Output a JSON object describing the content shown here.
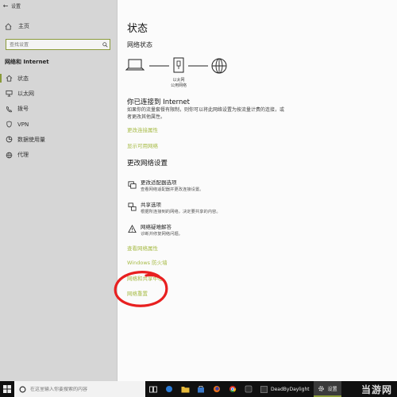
{
  "window": {
    "title": "设置"
  },
  "sidebar": {
    "home_label": "主页",
    "search_placeholder": "查找设置",
    "section_title": "网络和 Internet",
    "items": [
      {
        "label": "状态",
        "icon": "home-status-icon",
        "active": true
      },
      {
        "label": "以太网",
        "icon": "ethernet-icon",
        "active": false
      },
      {
        "label": "拨号",
        "icon": "phone-icon",
        "active": false
      },
      {
        "label": "VPN",
        "icon": "vpn-icon",
        "active": false
      },
      {
        "label": "数据使用量",
        "icon": "data-usage-icon",
        "active": false
      },
      {
        "label": "代理",
        "icon": "globe-icon",
        "active": false
      }
    ]
  },
  "main": {
    "title": "状态",
    "network_status_title": "网络状态",
    "diagram_label_line1": "以太网",
    "diagram_label_line2": "公用网络",
    "connected_heading": "你已连接到 Internet",
    "connected_desc": "如果你的流量套餐有限制，则你可以将此网络设置为按流量计费的连接，或者更改其他属性。",
    "link_change_props": "更改连接属性",
    "link_show_networks": "显示可用网络",
    "change_settings_heading": "更改网络设置",
    "options": [
      {
        "title": "更改适配器选项",
        "desc": "查看网络适配器并更改连接设置。",
        "icon": "adapter-icon"
      },
      {
        "title": "共享选项",
        "desc": "根据所连接到的网络，决定要共享的内容。",
        "icon": "share-icon"
      },
      {
        "title": "网络疑难解答",
        "desc": "诊断并修复网络问题。",
        "icon": "warning-icon"
      }
    ],
    "link_view_props": "查看网络属性",
    "link_firewall": "Windows 防火墙",
    "link_network_sharing": "网络和共享中心",
    "link_network_reset": "网络重置"
  },
  "taskbar": {
    "search_placeholder": "在这里输入你要搜索的内容",
    "app_label_1": "DeadByDaylight",
    "app_label_2": "设置"
  },
  "watermark": "当游网",
  "colors": {
    "accent": "#8a9a3a",
    "link": "#a7bb46",
    "annotation": "#e82020"
  }
}
